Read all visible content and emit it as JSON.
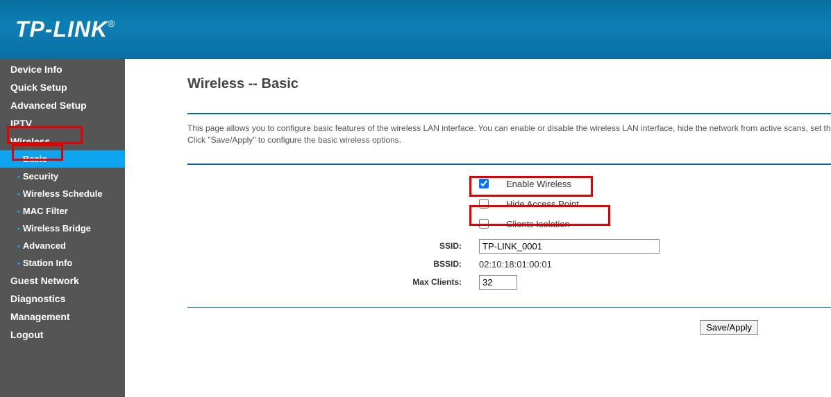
{
  "brand": "TP-LINK",
  "sidebar": {
    "items": [
      {
        "label": "Device Info",
        "sub": false
      },
      {
        "label": "Quick Setup",
        "sub": false
      },
      {
        "label": "Advanced Setup",
        "sub": false
      },
      {
        "label": "IPTV",
        "sub": false
      },
      {
        "label": "Wireless",
        "sub": false,
        "highlighted": true
      },
      {
        "label": "Basic",
        "sub": true,
        "selected": true,
        "highlighted": true
      },
      {
        "label": "Security",
        "sub": true
      },
      {
        "label": "Wireless Schedule",
        "sub": true
      },
      {
        "label": "MAC Filter",
        "sub": true
      },
      {
        "label": "Wireless Bridge",
        "sub": true
      },
      {
        "label": "Advanced",
        "sub": true
      },
      {
        "label": "Station Info",
        "sub": true
      },
      {
        "label": "Guest Network",
        "sub": false
      },
      {
        "label": "Diagnostics",
        "sub": false
      },
      {
        "label": "Management",
        "sub": false
      },
      {
        "label": "Logout",
        "sub": false
      }
    ]
  },
  "page": {
    "title": "Wireless -- Basic",
    "description": "This page allows you to configure basic features of the wireless LAN interface. You can enable or disable the wireless LAN interface, hide the network from active scans, set th\nClick \"Save/Apply\" to configure the basic wireless options.",
    "enable_wireless_label": "Enable Wireless",
    "enable_wireless_checked": true,
    "hide_ap_label": "Hide Access Point",
    "hide_ap_checked": false,
    "clients_isolation_label": "Clients Isolation",
    "clients_isolation_checked": false,
    "ssid_label": "SSID:",
    "ssid_value": "TP-LINK_0001",
    "bssid_label": "BSSID:",
    "bssid_value": "02:10:18:01:00:01",
    "max_clients_label": "Max Clients:",
    "max_clients_value": "32",
    "save_button": "Save/Apply"
  }
}
